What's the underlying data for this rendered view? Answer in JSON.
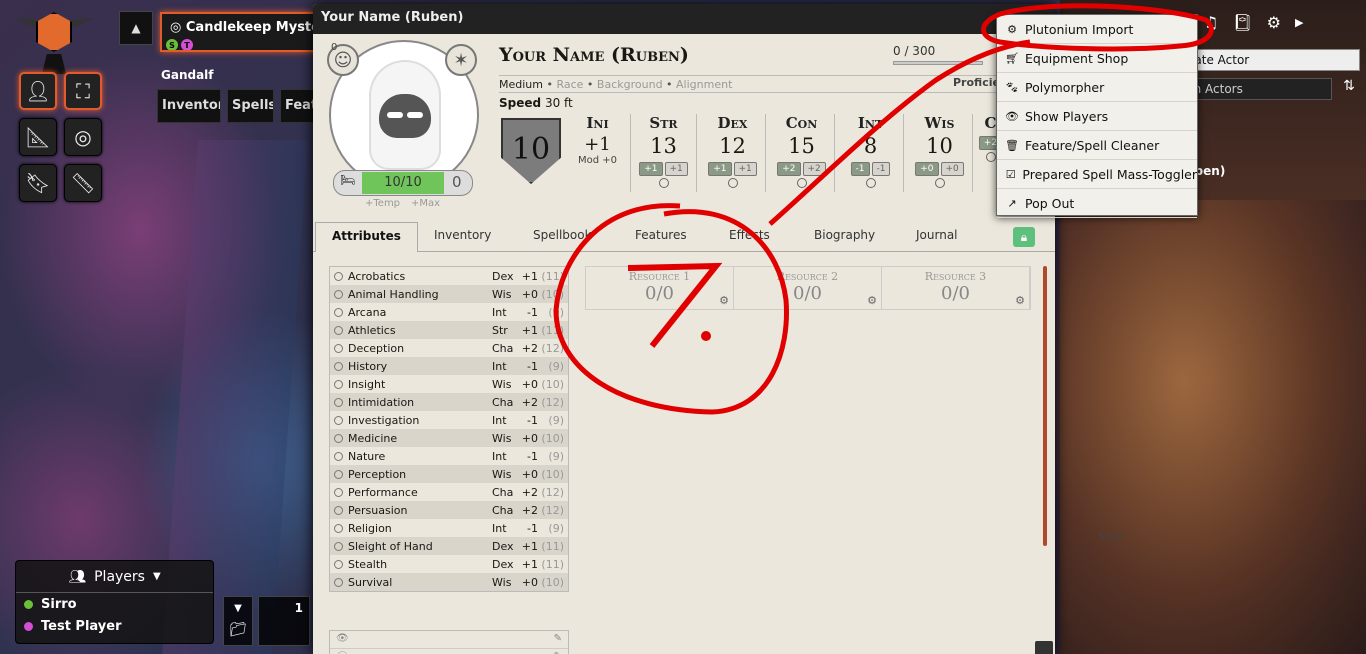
{
  "scene": {
    "title": "Candlekeep Mysteries",
    "badges": [
      "S",
      "T"
    ]
  },
  "user_name": "Gandalf",
  "header_tabs": [
    "Inventory",
    "Spells",
    "Featu"
  ],
  "players": {
    "title": "Players",
    "list": [
      {
        "name": "Sirro",
        "color": "#6bbf3a"
      },
      {
        "name": "Test Player",
        "color": "#d44fd4"
      }
    ]
  },
  "hotbar": {
    "page": "1"
  },
  "sheet": {
    "window_title": "Your Name (Ruben)",
    "name": "Your Name (Ruben)",
    "xp": "0 / 300",
    "size": "Medium",
    "race": "Race",
    "background": "Background",
    "alignment": "Alignment",
    "speed_label": "Speed",
    "speed_value": "30 ft",
    "proficiency_label": "Proficie",
    "ac": "10",
    "hp": "10/10",
    "hp_temp": "+Temp",
    "hp_max": "+Max",
    "inspiration": "0",
    "hd": "0",
    "initiative": {
      "label": "Ini",
      "value": "+1",
      "mod": "Mod +0"
    },
    "abilities": [
      {
        "label": "Str",
        "value": "13",
        "mod": "+1",
        "save": "+1"
      },
      {
        "label": "Dex",
        "value": "12",
        "mod": "+1",
        "save": "+1"
      },
      {
        "label": "Con",
        "value": "15",
        "mod": "+2",
        "save": "+2"
      },
      {
        "label": "Int",
        "value": "8",
        "mod": "-1",
        "save": "-1"
      },
      {
        "label": "Wis",
        "value": "10",
        "mod": "+0",
        "save": "+0"
      },
      {
        "label": "C",
        "value": "",
        "mod": "+2",
        "save": ""
      }
    ],
    "tabs": [
      "Attributes",
      "Inventory",
      "Spellbook",
      "Features",
      "Effects",
      "Biography",
      "Journal"
    ],
    "active_tab": "Attributes",
    "skills": [
      {
        "name": "Acrobatics",
        "ability": "Dex",
        "bonus": "+1",
        "passive": "(11)"
      },
      {
        "name": "Animal Handling",
        "ability": "Wis",
        "bonus": "+0",
        "passive": "(10)"
      },
      {
        "name": "Arcana",
        "ability": "Int",
        "bonus": "-1",
        "passive": "(9)"
      },
      {
        "name": "Athletics",
        "ability": "Str",
        "bonus": "+1",
        "passive": "(11)"
      },
      {
        "name": "Deception",
        "ability": "Cha",
        "bonus": "+2",
        "passive": "(12)"
      },
      {
        "name": "History",
        "ability": "Int",
        "bonus": "-1",
        "passive": "(9)"
      },
      {
        "name": "Insight",
        "ability": "Wis",
        "bonus": "+0",
        "passive": "(10)"
      },
      {
        "name": "Intimidation",
        "ability": "Cha",
        "bonus": "+2",
        "passive": "(12)"
      },
      {
        "name": "Investigation",
        "ability": "Int",
        "bonus": "-1",
        "passive": "(9)"
      },
      {
        "name": "Medicine",
        "ability": "Wis",
        "bonus": "+0",
        "passive": "(10)"
      },
      {
        "name": "Nature",
        "ability": "Int",
        "bonus": "-1",
        "passive": "(9)"
      },
      {
        "name": "Perception",
        "ability": "Wis",
        "bonus": "+0",
        "passive": "(10)"
      },
      {
        "name": "Performance",
        "ability": "Cha",
        "bonus": "+2",
        "passive": "(12)"
      },
      {
        "name": "Persuasion",
        "ability": "Cha",
        "bonus": "+2",
        "passive": "(12)"
      },
      {
        "name": "Religion",
        "ability": "Int",
        "bonus": "-1",
        "passive": "(9)"
      },
      {
        "name": "Sleight of Hand",
        "ability": "Dex",
        "bonus": "+1",
        "passive": "(11)"
      },
      {
        "name": "Stealth",
        "ability": "Dex",
        "bonus": "+1",
        "passive": "(11)"
      },
      {
        "name": "Survival",
        "ability": "Wis",
        "bonus": "+0",
        "passive": "(10)"
      }
    ],
    "resources": [
      {
        "label": "Resource 1",
        "value": "0/0"
      },
      {
        "label": "Resource 2",
        "value": "0/0"
      },
      {
        "label": "Resource 3",
        "value": "0/0"
      }
    ]
  },
  "right_panel": {
    "create_actor": "eate Actor",
    "search_placeholder": "ch Actors",
    "actor_name": "uben)"
  },
  "token_label": "Sirro",
  "menu": {
    "items": [
      {
        "label": "Plutonium Import",
        "icon": "gear-icon"
      },
      {
        "label": "Equipment Shop",
        "icon": "cart-icon"
      },
      {
        "label": "Polymorpher",
        "icon": "paw-icon"
      },
      {
        "label": "Show Players",
        "icon": "eye-icon"
      },
      {
        "label": "Feature/Spell Cleaner",
        "icon": "trash-icon"
      },
      {
        "label": "Prepared Spell Mass-Toggler",
        "icon": "checkbox-icon"
      },
      {
        "label": "Pop Out",
        "icon": "external-link-icon"
      }
    ]
  },
  "annotation": {
    "number": "7.",
    "color": "#e00000"
  }
}
